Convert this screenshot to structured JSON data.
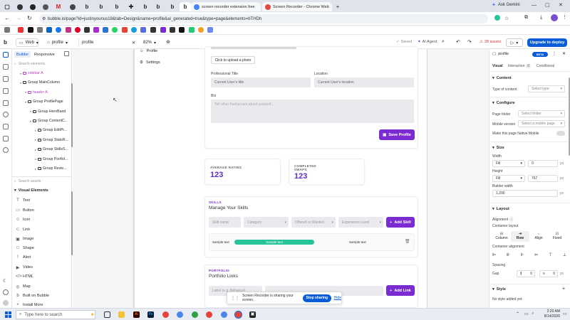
{
  "browser": {
    "tabs": [
      {
        "title": "screen recorder extension free"
      },
      {
        "title": "Screen Recorder - Chrome Web"
      }
    ],
    "url": "bubble.io/page?id=justinyounus18&tab=Design&name=profile&ai_generated=true&type=page&elements=bTHDh",
    "ask_gemini": "Ask Gemini"
  },
  "editor": {
    "app_selector": "b",
    "web_label": "Web",
    "page_name": "profile",
    "element_name": "profile",
    "zoom": "82%",
    "saved": "Saved",
    "ai_agent": "AI Agent",
    "issues": "28 issues",
    "upgrade": "Upgrade to deploy"
  },
  "left_panel": {
    "tab_builder": "Builder",
    "tab_responsive": "Responsive",
    "search_elements_placeholder": "Search elements",
    "tree": [
      {
        "label": "sidebar A",
        "indent": 1,
        "color": "#b83dc9"
      },
      {
        "label": "Group MainColumn",
        "indent": 1,
        "color": "#2b2b2b"
      },
      {
        "label": "header A",
        "indent": 2,
        "color": "#b83dc9"
      },
      {
        "label": "Group ProfilePage",
        "indent": 2,
        "color": "#2b2b2b"
      },
      {
        "label": "Group HeroBand",
        "indent": 3,
        "color": "#2b2b2b"
      },
      {
        "label": "Group ContentC...",
        "indent": 3,
        "color": "#2b2b2b"
      },
      {
        "label": "Group EditPr...",
        "indent": 4,
        "color": "#2b2b2b"
      },
      {
        "label": "Group StatsR...",
        "indent": 4,
        "color": "#2b2b2b"
      },
      {
        "label": "Group SkillsS...",
        "indent": 4,
        "color": "#2b2b2b"
      },
      {
        "label": "Group Portfol...",
        "indent": 4,
        "color": "#2b2b2b"
      },
      {
        "label": "Group Revie...",
        "indent": 4,
        "color": "#2b2b2b"
      }
    ],
    "search_assets_placeholder": "Search assets",
    "visual_elements_header": "Visual Elements",
    "visual_elements": [
      {
        "label": "Text",
        "icon": "T"
      },
      {
        "label": "Button",
        "icon": "▭"
      },
      {
        "label": "Icon",
        "icon": "☺"
      },
      {
        "label": "Link",
        "icon": "⊂"
      },
      {
        "label": "Image",
        "icon": "▣"
      },
      {
        "label": "Shape",
        "icon": "□"
      },
      {
        "label": "Alert",
        "icon": "!"
      },
      {
        "label": "Video",
        "icon": "▶"
      },
      {
        "label": "HTML",
        "icon": "</>"
      },
      {
        "label": "Map",
        "icon": "◎"
      },
      {
        "label": "Built on Bubble",
        "icon": "b"
      },
      {
        "label": "Install More",
        "icon": "+"
      }
    ]
  },
  "sidebar_nav": {
    "profile": "Profile",
    "settings": "Settings"
  },
  "profile_card": {
    "photo_button": "Click to upload a photo",
    "title_label": "Professional Title",
    "title_placeholder": "Current User's title",
    "location_label": "Location",
    "location_placeholder": "Current User's location",
    "bio_label": "Bio",
    "bio_placeholder": "Tell other freelancers about yourself...",
    "save_button": "Save Profile"
  },
  "stats": [
    {
      "label": "AVERAGE RATING",
      "value": "123"
    },
    {
      "label": "COMPLETED\nSWAPS",
      "value": "123"
    }
  ],
  "skills": {
    "eyebrow": "SKILLS",
    "title": "Manage Your Skills",
    "skill_name_placeholder": "Skill name",
    "category_placeholder": "Category",
    "offered_placeholder": "Offered or Wanted",
    "experience_placeholder": "Experience Level",
    "add_button": "Add Skill",
    "row_text": "Sample text",
    "row_pill": "Sample text",
    "row_text2": "Sample text"
  },
  "portfolio": {
    "eyebrow": "PORTFOLIO",
    "title": "Portfolio Links",
    "label_placeholder": "Label (e.g. Behance)",
    "add_button": "Add Link"
  },
  "right_panel": {
    "element_name": "profile",
    "beta": "BETA",
    "tab_visual": "Visual",
    "tab_interaction": "Interaction",
    "interaction_count": "0",
    "tab_conditional": "Conditional",
    "content_section": "Content",
    "type_of_content_label": "Type of content",
    "type_of_content_value": "Select type",
    "configure_section": "Configure",
    "page_folder_label": "Page folder",
    "page_folder_value": "Select folder",
    "mobile_version_label": "Mobile version",
    "mobile_version_value": "Select a mobile page",
    "native_mobile_label": "Make this page Native Mobile",
    "size_section": "Size",
    "width_label": "Width",
    "width_mode": "Fill",
    "width_min": "0",
    "width_unit": "px",
    "height_label": "Height",
    "height_mode": "Fill",
    "height_value": "767",
    "height_unit": "px",
    "builder_width_label": "Builder width",
    "builder_width_value": "1,200",
    "builder_width_unit": "px",
    "layout_section": "Layout",
    "alignment_label": "Alignment",
    "container_layout_label": "Container layout",
    "layouts": [
      "Column",
      "Row",
      "Align",
      "Fixed"
    ],
    "selected_layout": "Row",
    "container_alignment_label": "Container alignment",
    "spacing_label": "Spacing",
    "gap_label": "Gap",
    "gap_col": "0",
    "gap_row": "0",
    "gap_unit": "px",
    "style_section": "Style",
    "no_style": "No style added yet."
  },
  "share_bar": {
    "message": "Screen Recorder is sharing your screen.",
    "stop_button": "Stop sharing",
    "hide": "Hide"
  },
  "taskbar": {
    "search_placeholder": "Type here to search",
    "time": "2:20 AM",
    "date": "8/14/2026"
  },
  "colors": {
    "brand_purple": "#7a2bd1",
    "editor_blue": "#0a5cd6",
    "teal_progress": "#27c49a",
    "accent_pink": "#b83dc9"
  }
}
